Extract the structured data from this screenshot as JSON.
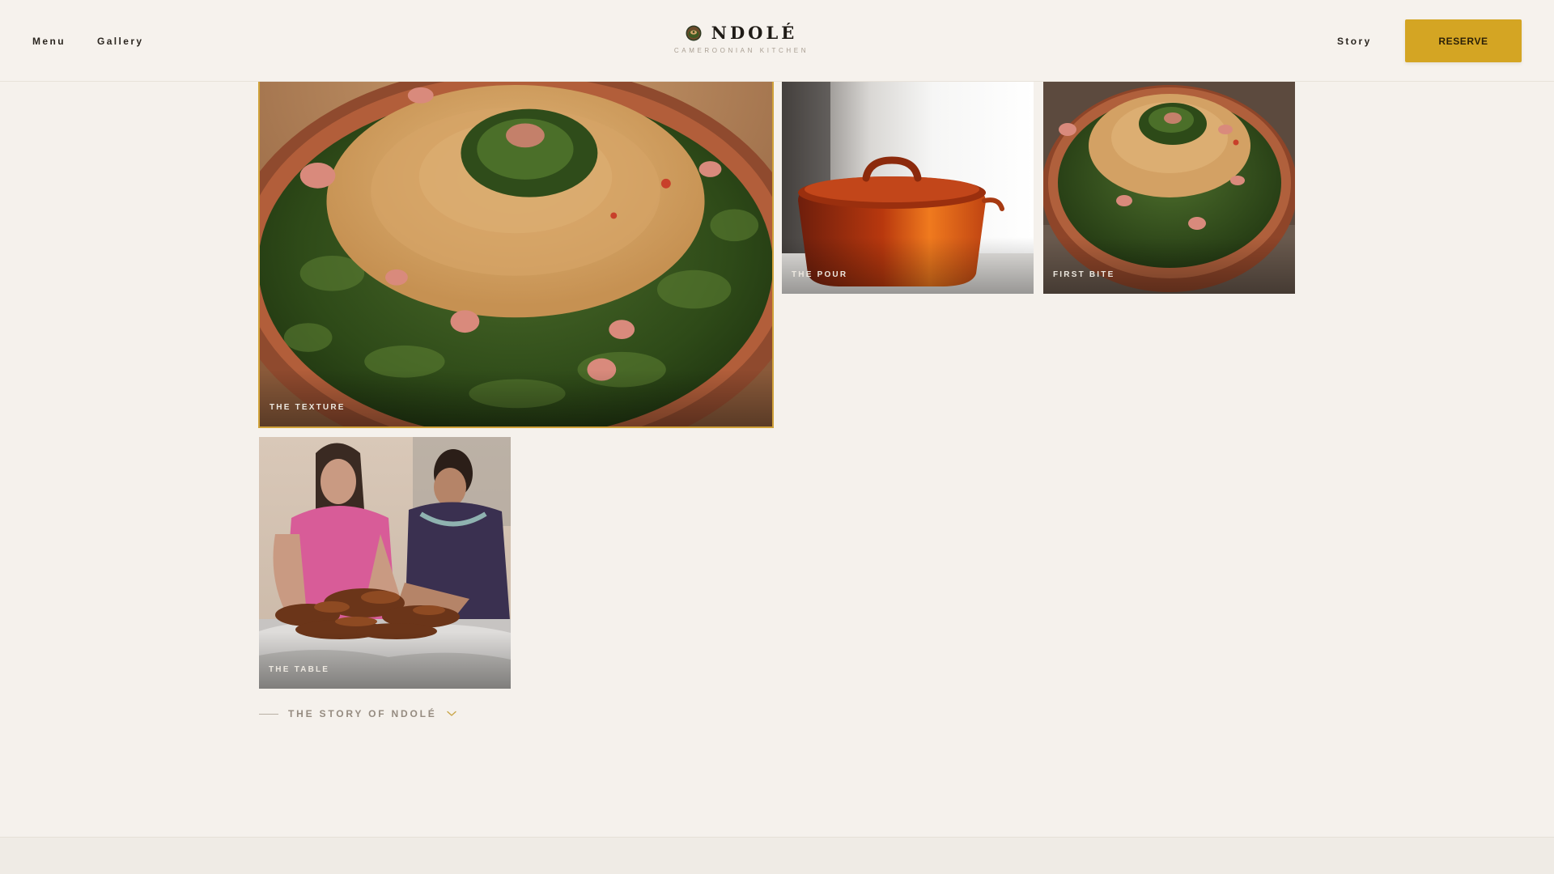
{
  "header": {
    "nav_left": [
      {
        "label": "Menu"
      },
      {
        "label": "Gallery"
      }
    ],
    "logo": {
      "title": "NDOLÉ",
      "subtitle": "CAMEROONIAN KITCHEN",
      "mark_icon": "ndole-bowl-logo-icon"
    },
    "nav_right": [
      {
        "label": "Story"
      }
    ],
    "reserve_label": "RESERVE"
  },
  "gallery": {
    "tiles": [
      {
        "label": "THE TEXTURE",
        "photo": "ndole-dish-closeup",
        "selected": true
      },
      {
        "label": "THE POUR",
        "photo": "red-dutch-oven"
      },
      {
        "label": "FIRST BITE",
        "photo": "ndole-bowl"
      },
      {
        "label": "THE TABLE",
        "photo": "diners-with-fried-plantain"
      }
    ]
  },
  "story_link": {
    "label": "THE STORY OF NDOLÉ",
    "icon": "chevron-down-icon"
  },
  "colors": {
    "background": "#f5f1ec",
    "accent_gold": "#d4a523",
    "selected_border": "#d0a23a",
    "text_dark": "#2b2620",
    "text_muted": "#958b80"
  }
}
